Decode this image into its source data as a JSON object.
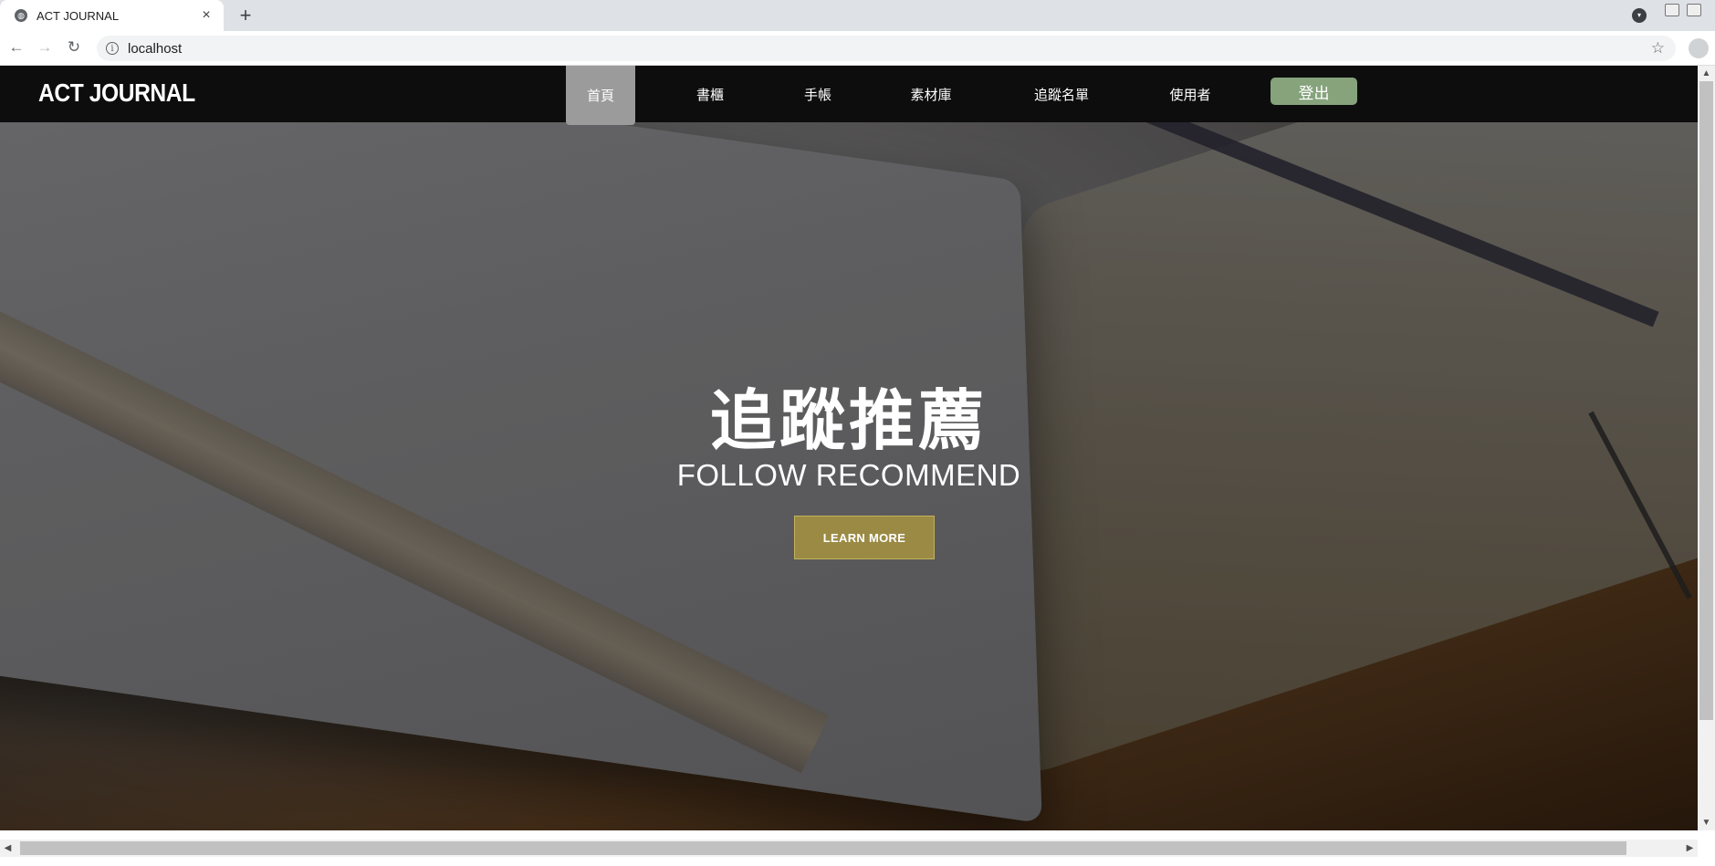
{
  "browser": {
    "tab_title": "ACT JOURNAL",
    "tab_close": "×",
    "new_tab": "+",
    "url": "localhost",
    "info_glyph": "i",
    "star_glyph": "☆",
    "back_glyph": "←",
    "forward_glyph": "→",
    "reload_glyph": "↻"
  },
  "site": {
    "brand": "ACT JOURNAL",
    "nav": [
      {
        "label": "首頁",
        "active": true
      },
      {
        "label": "書櫃"
      },
      {
        "label": "手帳"
      },
      {
        "label": "素材庫"
      },
      {
        "label": "追蹤名單"
      },
      {
        "label": "使用者"
      }
    ],
    "logout_label": "登出",
    "accent_logout": "#86a37c",
    "accent_button": "#9a8a44"
  },
  "hero": {
    "title": "追蹤推薦",
    "subtitle": "FOLLOW RECOMMEND",
    "button_label": "LEARN MORE"
  }
}
